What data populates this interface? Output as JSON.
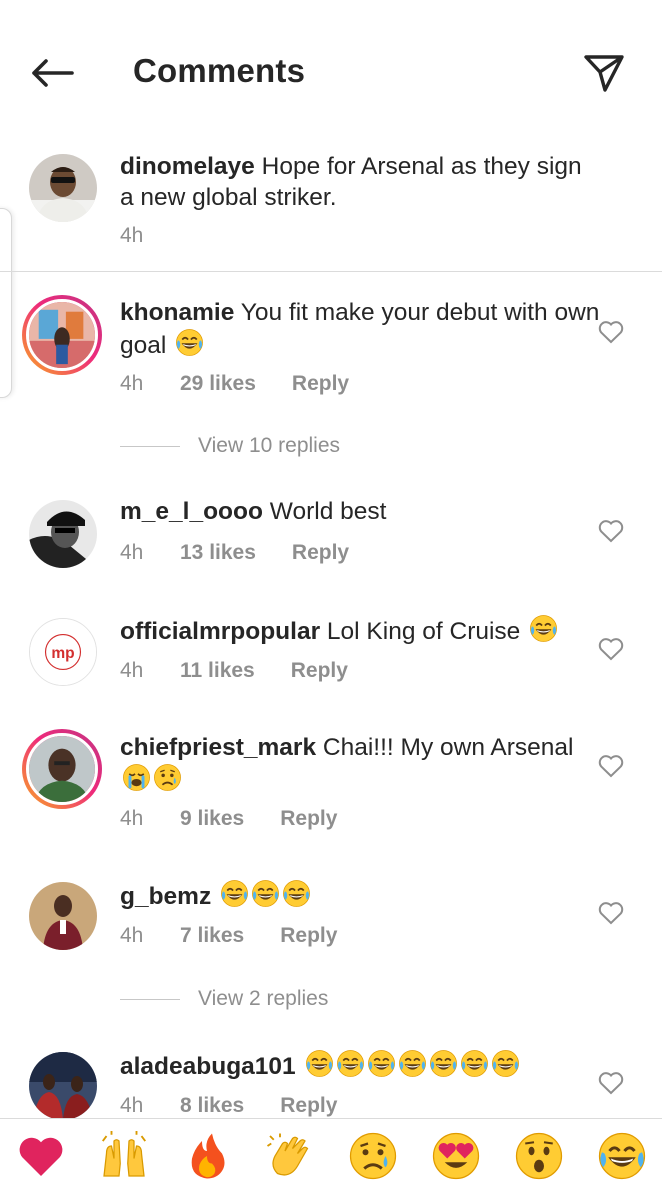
{
  "header": {
    "title": "Comments"
  },
  "caption": {
    "username": "dinomelaye",
    "text": "Hope for Arsenal as they sign a new global striker.",
    "time": "4h"
  },
  "comments": [
    {
      "username": "khonamie",
      "text": "You fit make your debut with own goal",
      "time": "4h",
      "likes": "29 likes",
      "reply": "Reply",
      "view_replies": "View 10 replies"
    },
    {
      "username": "m_e_l_oooo",
      "text": "World best",
      "time": "4h",
      "likes": "13 likes",
      "reply": "Reply"
    },
    {
      "username": "officialmrpopular",
      "text": "Lol King of Cruise",
      "time": "4h",
      "likes": "11 likes",
      "reply": "Reply"
    },
    {
      "username": "chiefpriest_mark",
      "text": "Chai!!! My own Arsenal",
      "time": "4h",
      "likes": "9 likes",
      "reply": "Reply"
    },
    {
      "username": "g_bemz",
      "text": "",
      "time": "4h",
      "likes": "7 likes",
      "reply": "Reply",
      "view_replies": "View 2 replies"
    },
    {
      "username": "aladeabuga101",
      "text": "",
      "time": "4h",
      "likes": "8 likes",
      "reply": "Reply"
    }
  ],
  "avatar_logo_text": "mp",
  "emoji_bar": [
    "red-heart-emoji",
    "raising-hands-emoji",
    "fire-emoji",
    "clapping-hands-emoji",
    "crying-face-emoji",
    "heart-eyes-emoji",
    "astonished-face-emoji",
    "tears-of-joy-emoji"
  ],
  "colors": {
    "text": "#262626",
    "secondary": "#8e8e8e",
    "divider": "#dbdbdb",
    "heart": "#e0245e"
  }
}
